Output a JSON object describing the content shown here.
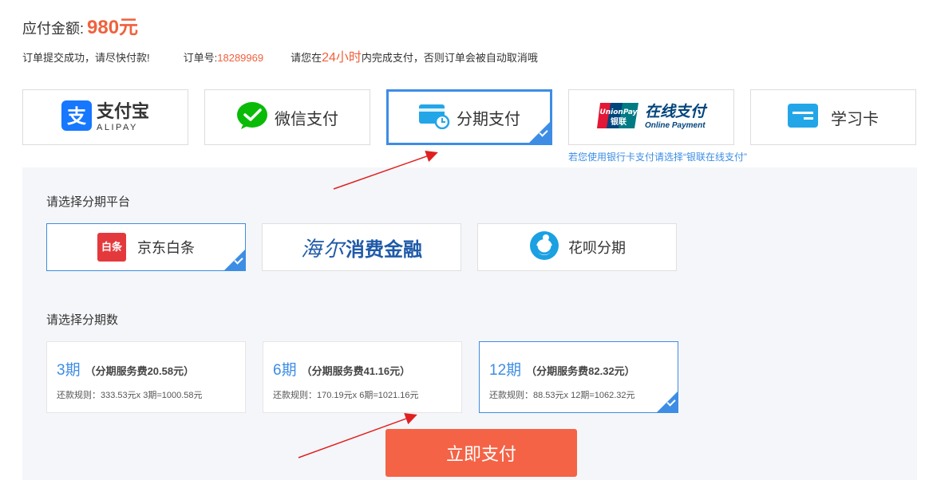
{
  "summary": {
    "amount_label": "应付金额:",
    "amount_value": "980元",
    "submit_msg": "订单提交成功，请尽快付款!",
    "order_label": "订单号:",
    "order_no": "18289969",
    "deadline_pre": "请您在",
    "deadline_hours": "24小时",
    "deadline_post": "内完成支付，否则订单会被自动取消哦"
  },
  "pay_methods": [
    {
      "label": "支付宝",
      "sub": "ALIPAY",
      "icon": "alipay-icon",
      "selected": false
    },
    {
      "label": "微信支付",
      "icon": "wechat-icon",
      "selected": false
    },
    {
      "label": "分期支付",
      "icon": "installment-card-icon",
      "selected": true
    },
    {
      "label": "在线支付",
      "sub": "Online Payment",
      "brand_top": "UnionPay",
      "brand_bottom": "银联",
      "icon": "unionpay-icon",
      "selected": false
    },
    {
      "label": "学习卡",
      "icon": "study-card-icon",
      "selected": false
    }
  ],
  "unionpay_hint": "若您使用银行卡支付请选择“银联在线支付”",
  "platform_section": {
    "title": "请选择分期平台",
    "platforms": [
      {
        "label": "京东白条",
        "logo_text": "白条",
        "icon": "jd-baitiao-icon",
        "selected": true
      },
      {
        "label": "海尔消费金融",
        "logo_part1": "海尔",
        "logo_part2": "消费金融",
        "icon": "haier-finance-logo",
        "selected": false
      },
      {
        "label": "花呗分期",
        "icon": "huabei-icon",
        "selected": false
      }
    ]
  },
  "term_section": {
    "title": "请选择分期数",
    "terms": [
      {
        "num": "3期",
        "fee": "（分期服务费20.58元）",
        "rule": "还款规则：333.53元x 3期=1000.58元",
        "selected": false
      },
      {
        "num": "6期",
        "fee": "（分期服务费41.16元）",
        "rule": "还款规则：170.19元x 6期=1021.16元",
        "selected": false
      },
      {
        "num": "12期",
        "fee": "（分期服务费82.32元）",
        "rule": "还款规则：88.53元x 12期=1062.32元",
        "selected": true
      }
    ]
  },
  "pay_button": "立即支付",
  "colors": {
    "accent_blue": "#3d8de5",
    "price_orange": "#f0613d",
    "button_orange": "#f46346",
    "panel_bg": "#f5f6f9",
    "annotation_red": "#e02020"
  }
}
